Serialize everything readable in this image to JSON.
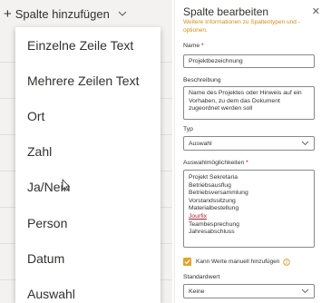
{
  "left": {
    "add_column_label": "Spalte hinzufügen",
    "menu_items": [
      "Einzelne Zeile Text",
      "Mehrere Zeilen Text",
      "Ort",
      "Zahl",
      "Ja/Nein",
      "Person",
      "Datum",
      "Auswahl"
    ]
  },
  "panel": {
    "title": "Spalte bearbeiten",
    "info_link": "Weitere Informationen zu Spaltentypen und -optionen.",
    "name_label": "Name",
    "required_mark": "*",
    "name_value": "Projektbezeichnung",
    "description_label": "Beschreibung",
    "description_value": "Name des Projektes oder Hinweis auf ein Vorhaben, zu dem das Dokument zugeordnet werden soll",
    "type_label": "Typ",
    "type_value": "Auswahl",
    "choices_label": "Auswahlmöglichkeiten",
    "choices": [
      "Projekt Sekretaria",
      "Betriebsausflug",
      "Betriebsversammlung",
      "Vorstandssitzung",
      "Materialbestellung",
      "Jourfix",
      "Teambesprechung",
      "Jahresabschluss"
    ],
    "manual_values_label": "Kann Werte manuell hinzufügen",
    "default_label": "Standardwert",
    "default_value": "Keine"
  },
  "colors": {
    "accent": "#e0a530",
    "link": "#d08f18",
    "required": "#a80000"
  }
}
